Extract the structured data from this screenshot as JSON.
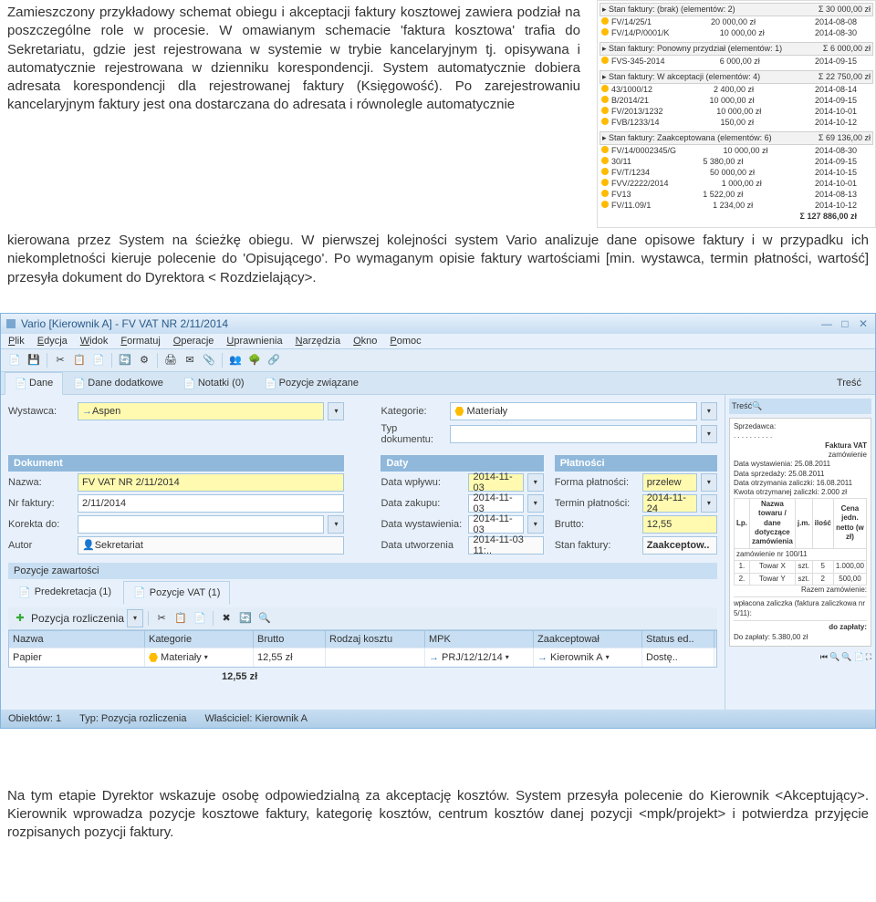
{
  "doc": {
    "p1": "Zamieszczony przykładowy schemat obiegu i akceptacji faktury kosztowej zawiera podział na poszczególne role w procesie. W omawianym schemacie 'faktura kosztowa' trafia do Sekretariatu, gdzie jest rejestrowana w systemie  w trybie kancelaryjnym tj. opisywana i automatycznie rejestrowana w dzienniku korespondencji. System automatycznie dobiera adresata korespondencji dla rejestrowanej faktury (Księgowość). Po zarejestrowaniu kancelaryjnym faktury jest ona dostarczana do adresata i równolegle automatycznie ",
    "p2": "kierowana przez System na ścieżkę obiegu. W pierwszej kolejności system Vario analizuje dane opisowe faktury i w przypadku ich niekompletności kieruje polecenie do 'Opisującego'. Po wymaganym opisie faktury wartościami [min. wystawca, termin płatności, wartość] przesyła dokument do Dyrektora < Rozdzielający>.",
    "p3": "Na tym etapie Dyrektor wskazuje osobę odpowiedzialną za akceptację kosztów. System przesyła polecenie do Kierownik <Akceptujący>. Kierownik wprowadza pozycje kosztowe faktury, kategorię kosztów, centrum kosztów danej pozycji <mpk/projekt> i potwierdza przyjęcie rozpisanych pozycji faktury."
  },
  "side_groups": [
    {
      "h": "Stan faktury: (brak) (elementów: 2)",
      "sum": "Σ  30 000,00 zł",
      "rows": [
        [
          "FV/14/25/1",
          "20 000,00 zł",
          "2014-08-08"
        ],
        [
          "FV/14/P/0001/K",
          "10 000,00 zł",
          "2014-08-30"
        ]
      ]
    },
    {
      "h": "Stan faktury: Ponowny przydział (elementów: 1)",
      "sum": "Σ  6 000,00 zł",
      "rows": [
        [
          "FVS-345-2014",
          "6 000,00 zł",
          "2014-09-15"
        ]
      ]
    },
    {
      "h": "Stan faktury: W akceptacji (elementów: 4)",
      "sum": "Σ  22 750,00 zł",
      "rows": [
        [
          "43/1000/12",
          "2 400,00 zł",
          "2014-08-14"
        ],
        [
          "B/2014/21",
          "10 000,00 zł",
          "2014-09-15"
        ],
        [
          "FV/2013/1232",
          "10 000,00 zł",
          "2014-10-01"
        ],
        [
          "FVB/1233/14",
          "150,00 zł",
          "2014-10-12"
        ]
      ]
    },
    {
      "h": "Stan faktury: Zaakceptowana (elementów: 6)",
      "sum": "Σ  69 136,00 zł",
      "rows": [
        [
          "FV/14/0002345/G",
          "10 000,00 zł",
          "2014-08-30"
        ],
        [
          "30/11",
          "5 380,00 zł",
          "2014-09-15"
        ],
        [
          "FV/T/1234",
          "50 000,00 zł",
          "2014-10-15"
        ],
        [
          "FVV/2222/2014",
          "1 000,00 zł",
          "2014-10-01"
        ],
        [
          "FV13",
          "1 522,00 zł",
          "2014-08-13"
        ],
        [
          "FV/11.09/1",
          "1 234,00 zł",
          "2014-10-12"
        ]
      ],
      "total": "Σ  127 886,00 zł"
    }
  ],
  "app": {
    "title": "Vario [Kierownik A] - FV VAT NR 2/11/2014",
    "menus": [
      "Plik",
      "Edycja",
      "Widok",
      "Formatuj",
      "Operacje",
      "Uprawnienia",
      "Narzędzia",
      "Okno",
      "Pomoc"
    ],
    "tabs": [
      {
        "l": "Dane",
        "a": true
      },
      {
        "l": "Dane dodatkowe"
      },
      {
        "l": "Notatki (0)"
      },
      {
        "l": "Pozycje związane"
      }
    ],
    "tresc": "Treść",
    "f": {
      "wystawca_l": "Wystawca:",
      "wystawca": "Aspen",
      "kategorie_l": "Kategorie:",
      "kategorie": "Materiały",
      "typdok_l": "Typ dokumentu:",
      "dokument_h": "Dokument",
      "daty_h": "Daty",
      "plat_h": "Płatności",
      "nazwa_l": "Nazwa:",
      "nazwa": "FV VAT NR 2/11/2014",
      "nrf_l": "Nr faktury:",
      "nrf": "2/11/2014",
      "kor_l": "Korekta do:",
      "autor_l": "Autor",
      "autor": "Sekretariat",
      "dw_l": "Data wpływu:",
      "dw": "2014-11-03",
      "dz_l": "Data zakupu:",
      "dz": "2014-11-03",
      "dwy_l": "Data wystawienia:",
      "dwy": "2014-11-03",
      "du_l": "Data utworzenia",
      "du": "2014-11-03 11:..",
      "fp_l": "Forma płatności:",
      "fp": "przelew",
      "tp_l": "Termin płatności:",
      "tp": "2014-11-24",
      "br_l": "Brutto:",
      "br": "12,55",
      "sf_l": "Stan faktury:",
      "sf": "Zaakceptow.."
    },
    "poz": {
      "h": "Pozycje zawartości",
      "t1": "Predekretacja (1)",
      "t2": "Pozycje VAT (1)",
      "btn": "Pozycja rozliczenia",
      "cols": [
        "Nazwa",
        "Kategorie",
        "Brutto",
        "Rodzaj kosztu",
        "MPK",
        "Zaakceptował",
        "Status ed.."
      ],
      "row": [
        "Papier",
        "Materiały",
        "12,55 zł",
        "",
        "PRJ/12/12/14",
        "Kierownik A",
        "Dostę.."
      ],
      "sum": "12,55 zł"
    },
    "status": {
      "o": "Obiektów:  1",
      "t": "Typ: Pozycja rozliczenia",
      "w": "Właściciel: Kierownik A"
    },
    "prev": {
      "sprzed": "Sprzedawca:",
      "fakt": "Faktura VAT",
      "zam": "zamówienie",
      "l1": "Data wystawienia: 25.08.2011",
      "l2": "Data sprzedaży: 25.08.2011",
      "l3": "Data otrzymania zaliczki: 16.08.2011",
      "l4": "Kwota otrzymanej zaliczki: 2.000 zł",
      "th": [
        "Lp.",
        "Nazwa towaru / dane dotyczące zamówienia",
        "j.m.",
        "ilość",
        "Cena jedn. netto (w zł)"
      ],
      "zh": "zamówienie nr 100/11",
      "r1": [
        "1.",
        "Towar X",
        "szt.",
        "5",
        "1.000,00"
      ],
      "r2": [
        "2.",
        "Towar Y",
        "szt.",
        "2",
        "500,00"
      ],
      "raz": "Razem zamówienie:",
      "wp": "wpłacona zaliczka (faktura zaliczkowa nr 5/11):",
      "dz": "do zapłaty:",
      "dzv": "Do zapłaty: 5.380,00 zł"
    }
  }
}
